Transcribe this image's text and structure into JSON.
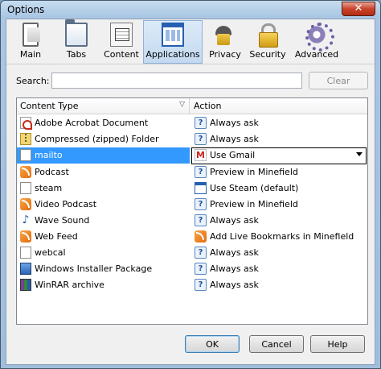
{
  "window": {
    "title": "Options",
    "close_glyph": "✕"
  },
  "toolbar": {
    "items": [
      {
        "label": "Main",
        "icon": "main-icon"
      },
      {
        "label": "Tabs",
        "icon": "tabs-icon"
      },
      {
        "label": "Content",
        "icon": "content-icon"
      },
      {
        "label": "Applications",
        "icon": "applications-icon",
        "selected": true
      },
      {
        "label": "Privacy",
        "icon": "privacy-icon"
      },
      {
        "label": "Security",
        "icon": "security-icon"
      },
      {
        "label": "Advanced",
        "icon": "advanced-icon"
      }
    ]
  },
  "search": {
    "label": "Search:",
    "value": "",
    "clear_label": "Clear"
  },
  "list": {
    "headers": {
      "content_type": "Content Type",
      "action": "Action"
    },
    "rows": [
      {
        "content_type": "Adobe Acrobat Document",
        "action": "Always ask",
        "ct_icon": "pdf-icon",
        "action_icon": "ask-icon"
      },
      {
        "content_type": "Compressed (zipped) Folder",
        "action": "Always ask",
        "ct_icon": "zip-folder-icon",
        "action_icon": "ask-icon"
      },
      {
        "content_type": "mailto",
        "action": "Use Gmail",
        "ct_icon": "document-icon",
        "action_icon": "gmail-icon",
        "selected": true
      },
      {
        "content_type": "Podcast",
        "action": "Preview in Minefield",
        "ct_icon": "feed-icon",
        "action_icon": "ask-icon"
      },
      {
        "content_type": "steam",
        "action": "Use Steam (default)",
        "ct_icon": "document-icon",
        "action_icon": "window-icon"
      },
      {
        "content_type": "Video Podcast",
        "action": "Preview in Minefield",
        "ct_icon": "feed-icon",
        "action_icon": "ask-icon"
      },
      {
        "content_type": "Wave Sound",
        "action": "Always ask",
        "ct_icon": "music-note-icon",
        "action_icon": "ask-icon"
      },
      {
        "content_type": "Web Feed",
        "action": "Add Live Bookmarks in Minefield",
        "ct_icon": "feed-icon",
        "action_icon": "feed-icon"
      },
      {
        "content_type": "webcal",
        "action": "Always ask",
        "ct_icon": "document-icon",
        "action_icon": "ask-icon"
      },
      {
        "content_type": "Windows Installer Package",
        "action": "Always ask",
        "ct_icon": "installer-icon",
        "action_icon": "ask-icon"
      },
      {
        "content_type": "WinRAR archive",
        "action": "Always ask",
        "ct_icon": "rar-icon",
        "action_icon": "ask-icon"
      }
    ]
  },
  "buttons": {
    "ok": "OK",
    "cancel": "Cancel",
    "help": "Help"
  },
  "colors": {
    "selection": "#3399ff",
    "accent": "#245fb1"
  }
}
